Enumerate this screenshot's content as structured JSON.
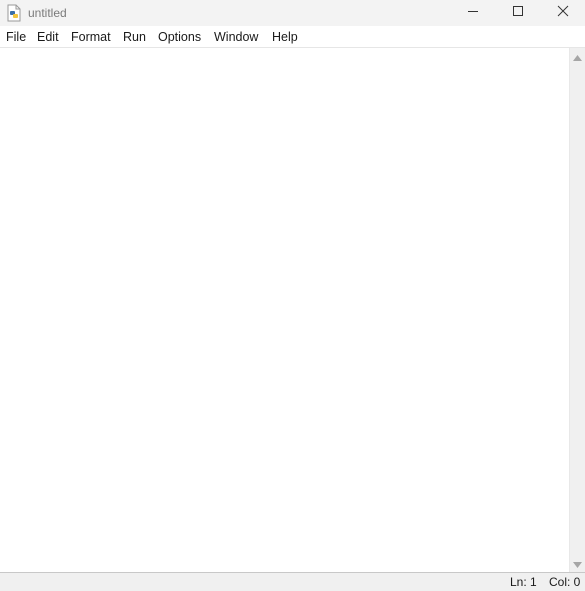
{
  "window": {
    "title": "untitled"
  },
  "menu": {
    "items": [
      {
        "label": "File"
      },
      {
        "label": "Edit"
      },
      {
        "label": "Format"
      },
      {
        "label": "Run"
      },
      {
        "label": "Options"
      },
      {
        "label": "Window"
      },
      {
        "label": "Help"
      }
    ]
  },
  "editor": {
    "content": ""
  },
  "status": {
    "line": "Ln: 1",
    "column": "Col: 0"
  },
  "icons": {
    "app": "python-idle-icon",
    "minimize": "minimize-icon",
    "maximize": "maximize-icon",
    "close": "close-icon",
    "scroll_up": "scroll-up-arrow-icon",
    "scroll_down": "scroll-down-arrow-icon"
  },
  "colors": {
    "titlebar": "#f3f3f3",
    "title_text": "#7a7a7a",
    "editor_bg": "#ffffff",
    "chrome": "#f0f0f0"
  }
}
